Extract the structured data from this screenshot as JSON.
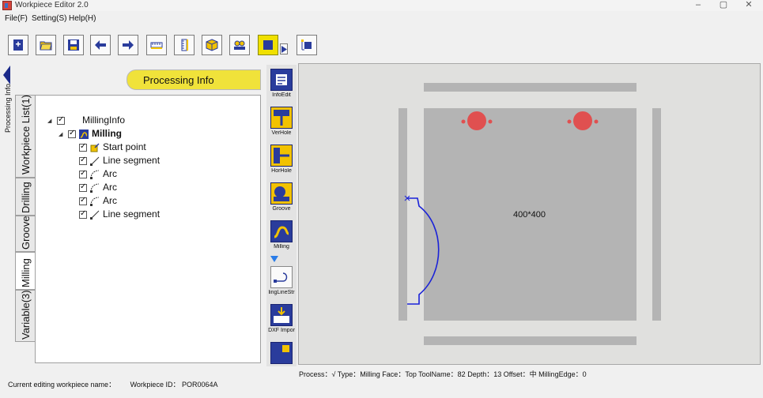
{
  "window": {
    "title": "Workpiece Editor 2.0",
    "minimize": "–",
    "maximize": "▢",
    "close": "✕"
  },
  "menu": [
    "File(F)",
    "Setting(S)",
    "Help(H)"
  ],
  "toolbar": {
    "buttons": [
      "new-file",
      "open-folder",
      "save",
      "undo",
      "redo",
      "ruler-h",
      "ruler-v",
      "3d-view",
      "machine",
      "highlight",
      "expand",
      "frame-tool"
    ]
  },
  "sidebar": {
    "collapsed_label": "Processing Info"
  },
  "tabs": [
    "Workpiece List(1)",
    "Drilling",
    "Groove",
    "Milling",
    "Variable(3)"
  ],
  "panel": {
    "header": "Processing Info",
    "tree": [
      {
        "label": "MillingInfo",
        "level": 0,
        "bold": false,
        "icon": "none",
        "expander": "◢"
      },
      {
        "label": "Milling",
        "level": 1,
        "bold": true,
        "icon": "milling",
        "expander": "◢"
      },
      {
        "label": "Start point",
        "level": 2,
        "bold": false,
        "icon": "start"
      },
      {
        "label": "Line segment",
        "level": 2,
        "bold": false,
        "icon": "line"
      },
      {
        "label": "Arc",
        "level": 2,
        "bold": false,
        "icon": "arc"
      },
      {
        "label": "Arc",
        "level": 2,
        "bold": false,
        "icon": "arc"
      },
      {
        "label": "Arc",
        "level": 2,
        "bold": false,
        "icon": "arc"
      },
      {
        "label": "Line segment",
        "level": 2,
        "bold": false,
        "icon": "line"
      }
    ]
  },
  "tools": [
    {
      "label": "InfoEdit"
    },
    {
      "label": "VerHole"
    },
    {
      "label": "HorHole"
    },
    {
      "label": "Groove"
    },
    {
      "label": "Milling"
    },
    {
      "label": "lingLineStr"
    },
    {
      "label": "DXF Impor"
    },
    {
      "label": ""
    }
  ],
  "canvas": {
    "dimension_label": "400*400"
  },
  "status": "Process：√  Type：Milling  Face：Top ToolName：82  Depth：13  Offset：中 MillingEdge：0",
  "footer": {
    "editing_label": "Current editing workpiece name：",
    "workpiece_id_label": "Workpiece ID：",
    "workpiece_id": "POR0064A"
  },
  "colors": {
    "accent_yellow": "#f0e23a",
    "icon_blue": "#2a3c9c",
    "board_gray": "#b4b4b4",
    "hole_red": "#e05050",
    "path_blue": "#1a22d8"
  }
}
